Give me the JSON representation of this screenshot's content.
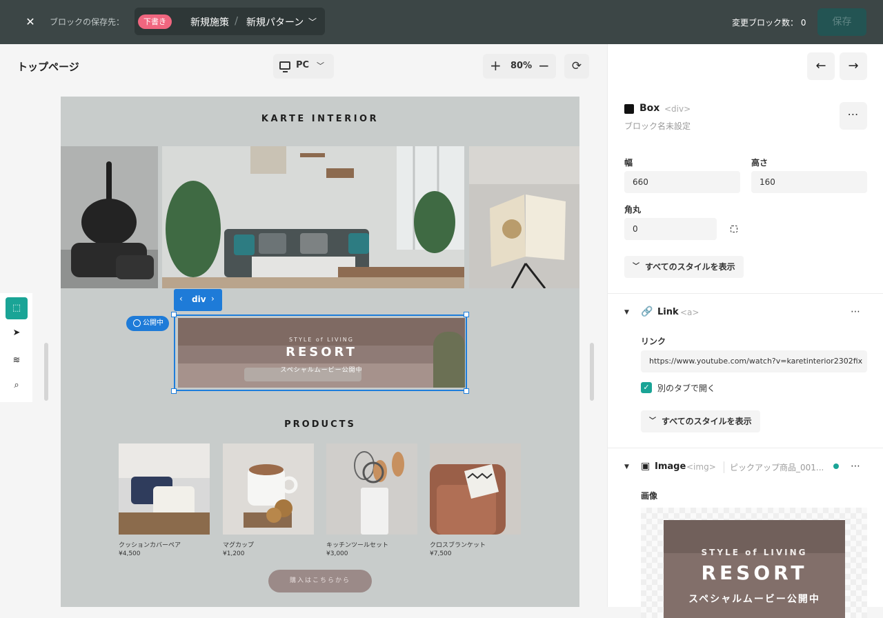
{
  "topbar": {
    "close_icon": "close-icon",
    "save_destination_label": "ブロックの保存先：",
    "draft_badge": "下書き",
    "campaign_name": "新規施策",
    "separator": "/",
    "pattern_name": "新規パターン",
    "changed_blocks_label": "変更ブロック数：",
    "changed_blocks_count": "0",
    "save_label": "保存"
  },
  "toolbar": {
    "page_name": "トップページ",
    "device": "PC",
    "zoom": "80%"
  },
  "site": {
    "brand": "KARTE INTERIOR",
    "banner": {
      "line1": "STYLE of LIVING",
      "line2": "RESORT",
      "line3": "スペシャルムービー公開中"
    },
    "products_heading": "PRODUCTS",
    "products": [
      {
        "name": "クッションカバーペア",
        "price": "¥4,500",
        "color": "#3d4a6a"
      },
      {
        "name": "マグカップ",
        "price": "¥1,200",
        "color": "#d8d4cf"
      },
      {
        "name": "キッチンツールセット",
        "price": "¥3,000",
        "color": "#c9c6c2"
      },
      {
        "name": "クロスブランケット",
        "price": "¥7,500",
        "color": "#8e5a48"
      }
    ],
    "buy_button": "購入はこちらから"
  },
  "selection": {
    "tag": "div",
    "status": "公開中"
  },
  "panel": {
    "box": {
      "title": "Box",
      "tag": "<div>",
      "subtitle": "ブロック名未設定",
      "width_label": "幅",
      "width_value": "660",
      "height_label": "高さ",
      "height_value": "160",
      "radius_label": "角丸",
      "radius_value": "0",
      "show_all": "すべてのスタイルを表示"
    },
    "link": {
      "title": "Link",
      "tag": "<a>",
      "field_label": "リンク",
      "url": "https://www.youtube.com/watch?v=karetinterior2302fix",
      "new_tab_label": "別のタブで開く",
      "show_all": "すべてのスタイルを表示"
    },
    "image": {
      "title": "Image",
      "tag": "<img>",
      "file_name": "ピックアップ商品_001...",
      "field_label": "画像",
      "preview_line1": "STYLE of LIVING",
      "preview_line2": "RESORT",
      "preview_line3": "スペシャルムービー公開中"
    }
  }
}
